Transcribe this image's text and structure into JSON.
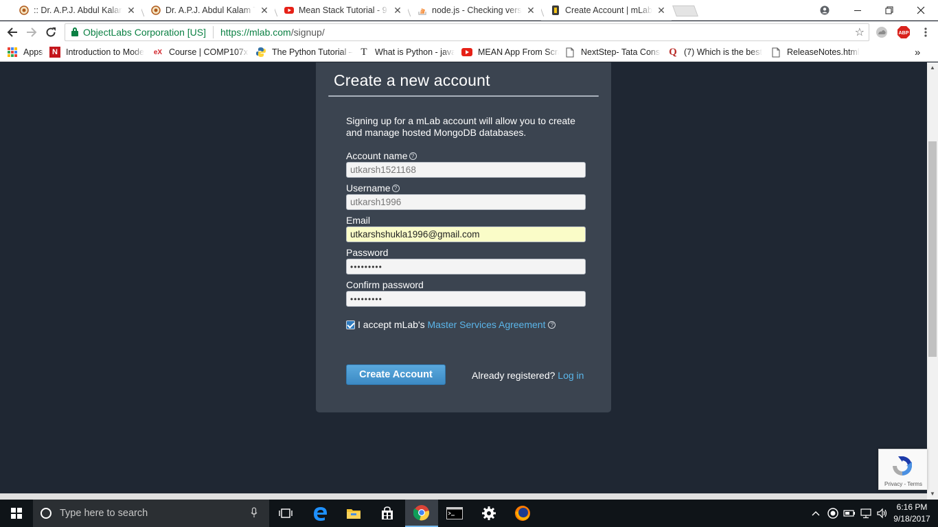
{
  "browser": {
    "tabs": [
      {
        "title": ":: Dr. A.P.J. Abdul Kalam Te",
        "icon": "apj-logo-icon"
      },
      {
        "title": "Dr. A.P.J. Abdul Kalam Te",
        "icon": "apj-logo-icon"
      },
      {
        "title": "Mean Stack Tutorial - 9",
        "icon": "youtube-icon"
      },
      {
        "title": "node.js - Checking versio",
        "icon": "stackoverflow-icon"
      },
      {
        "title": "Create Account | mLab",
        "icon": "mlab-icon"
      }
    ],
    "close_glyph": "✕",
    "address": {
      "org": "ObjectLabs Corporation [US]",
      "url_scheme_host": "https://mlab.com",
      "url_path": "/signup/"
    },
    "bookmarks": [
      {
        "label": "Apps",
        "icon": "apps-grid-icon"
      },
      {
        "label": "Introduction to Mode",
        "icon": "nptel-icon"
      },
      {
        "label": "Course | COMP107x |",
        "icon": "edx-icon"
      },
      {
        "label": "The Python Tutorial –",
        "icon": "python-icon"
      },
      {
        "label": "What is Python - java",
        "icon": "javatpoint-icon"
      },
      {
        "label": "MEAN App From Scra",
        "icon": "youtube-icon"
      },
      {
        "label": "NextStep- Tata Consu",
        "icon": "page-icon"
      },
      {
        "label": "(7) Which is the best",
        "icon": "quora-icon"
      },
      {
        "label": "ReleaseNotes.html",
        "icon": "page-icon"
      }
    ],
    "bookmarks_overflow": "»",
    "extensions": {
      "abp": "ABP"
    }
  },
  "signup": {
    "title": "Create a new account",
    "intro": "Signing up for a mLab account will allow you to create and manage hosted MongoDB databases.",
    "help_glyph": "?",
    "fields": {
      "account_name": {
        "label": "Account name",
        "value": "utkarsh1521168"
      },
      "username": {
        "label": "Username",
        "value": "utkarsh1996"
      },
      "email": {
        "label": "Email",
        "value": "utkarshshukla1996@gmail.com"
      },
      "password": {
        "label": "Password",
        "value": "•••••••••"
      },
      "confirm_password": {
        "label": "Confirm password",
        "value": "•••••••••"
      }
    },
    "agree": {
      "prefix": "I accept mLab's ",
      "link": "Master Services Agreement",
      "checked": true
    },
    "create_button": "Create Account",
    "already_text": "Already registered? ",
    "login_link": "Log in"
  },
  "recaptcha": {
    "footer": "Privacy - Terms"
  },
  "taskbar": {
    "search_placeholder": "Type here to search",
    "apps": [
      "task-view-icon",
      "edge-icon",
      "file-explorer-icon",
      "store-icon",
      "chrome-icon",
      "cmd-icon",
      "settings-icon",
      "firefox-icon"
    ],
    "active_app": "chrome-icon",
    "clock": {
      "time": "6:16 PM",
      "date": "9/18/2017"
    }
  }
}
